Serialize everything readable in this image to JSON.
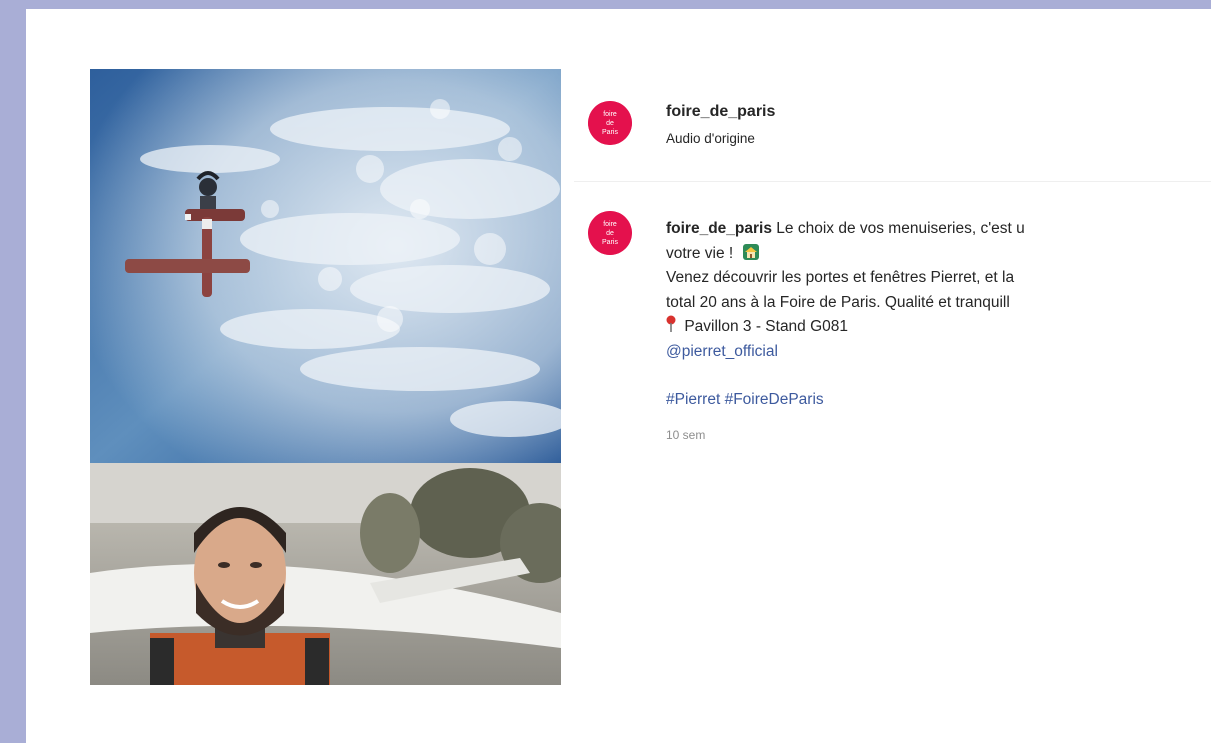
{
  "post": {
    "account": "foire_de_paris",
    "audio": "Audio d'origine",
    "avatar_logo_text": [
      "foire",
      "de",
      "Paris"
    ],
    "brand_color": "#e4114d",
    "caption": {
      "user": "foire_de_paris",
      "line1_text": "Le choix de vos menuiseries, c'est u",
      "line2_text": "votre vie !",
      "line2_icon": "house-icon",
      "line3": "Venez découvrir les portes et fenêtres Pierret, et la",
      "line4": "total 20 ans à la Foire de Paris. Qualité et tranquill",
      "line5_icon": "pin-icon",
      "line5_text": "Pavillon 3 - Stand G081",
      "mention": "@pierret_official",
      "hashtags": "#Pierret #FoireDeParis"
    },
    "timestamp": "10 sem",
    "link_color": "#3d5a9e"
  },
  "media": {
    "top_image": "skydiver-and-plane-in-cloudy-sky",
    "bottom_image": "smiling-skydiver-portrait-near-plane"
  }
}
